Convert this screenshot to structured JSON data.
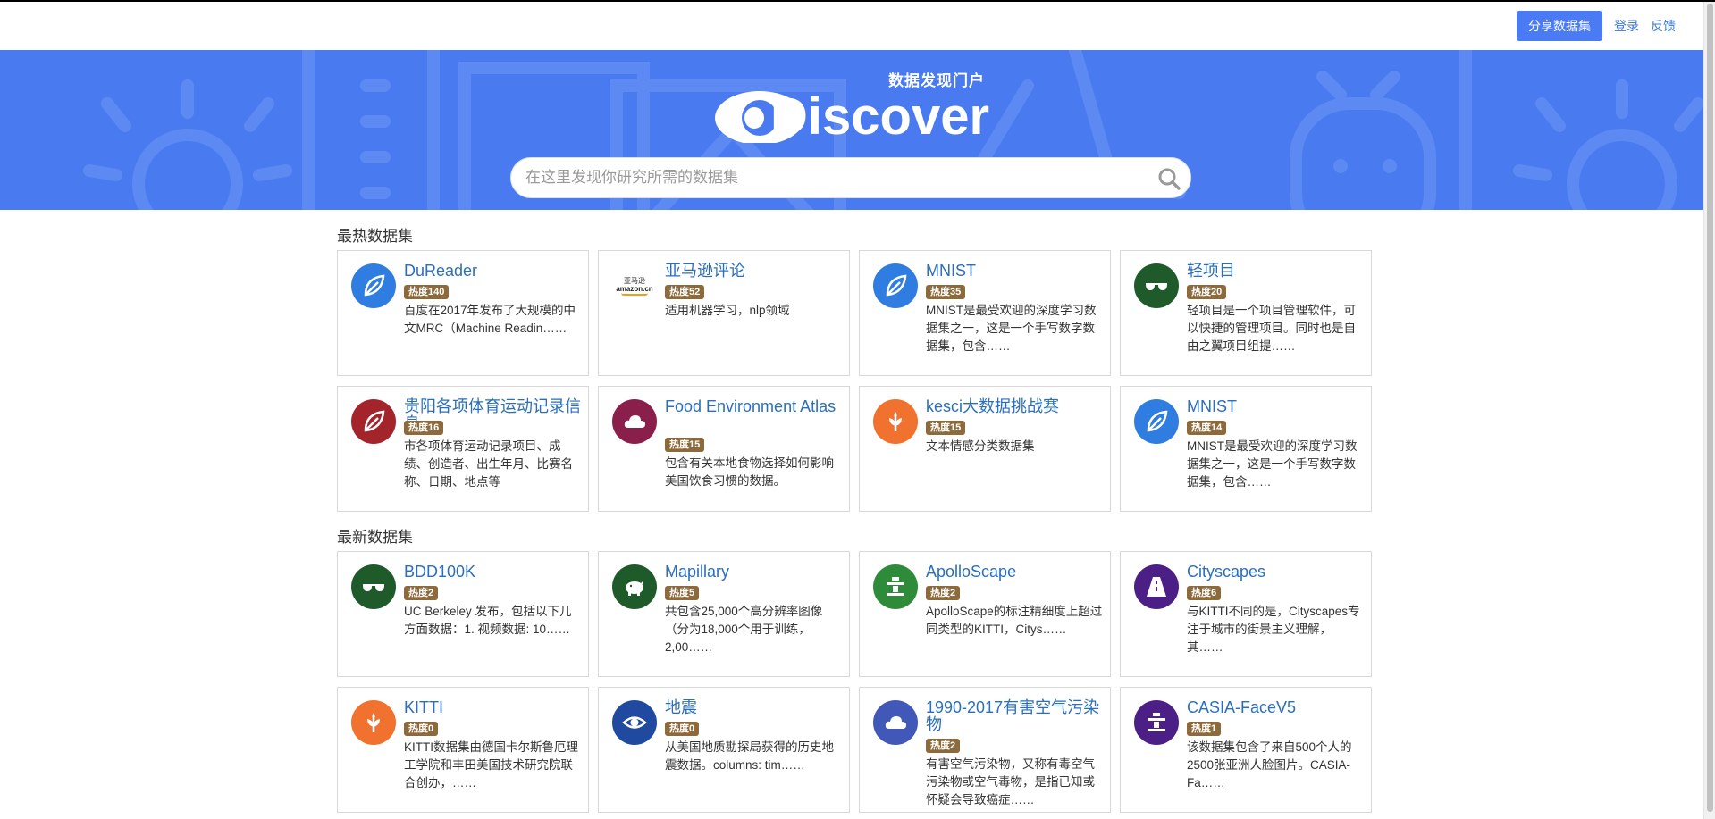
{
  "nav": {
    "share_label": "分享数据集",
    "login_label": "登录",
    "feedback_label": "反馈"
  },
  "hero": {
    "subtitle": "数据发现门户",
    "logo_text": "Discover",
    "search_placeholder": "在这里发现你研究所需的数据集"
  },
  "hot": {
    "title": "最热数据集",
    "cards": [
      {
        "title": "DuReader",
        "badge": "热度140",
        "desc": "百度在2017年发布了大规模的中文MRC（Machine Readin……",
        "icon": "leaf-icon",
        "color": "#2f7de1"
      },
      {
        "title": "亚马逊评论",
        "badge": "热度52",
        "desc": "适用机器学习，nlp领域",
        "icon": "amazon-logo",
        "logo_text": "亚马逊",
        "logo_sub": "amazon.cn"
      },
      {
        "title": "MNIST",
        "badge": "热度35",
        "desc": "MNIST是最受欢迎的深度学习数据集之一，这是一个手写数字数据集，包含……",
        "icon": "leaf-icon",
        "color": "#2f7de1"
      },
      {
        "title": "轻项目",
        "badge": "热度20",
        "desc": "轻项目是一个项目管理软件，可以快捷的管理项目。同时也是自由之翼项目组提……",
        "icon": "glasses-icon",
        "color": "#1f5a2a"
      },
      {
        "title": "贵阳各项体育运动记录信息",
        "badge": "热度16",
        "desc": "市各项体育运动记录项目、成绩、创造者、出生年月、比赛名称、日期、地点等",
        "icon": "leaf-icon",
        "color": "#a4242c"
      },
      {
        "title": "Food Environment Atlas",
        "badge": "热度15",
        "desc": "包含有关本地食物选择如何影响美国饮食习惯的数据。",
        "icon": "cloud-icon",
        "color": "#8a1f4c"
      },
      {
        "title": "kesci大数据挑战赛",
        "badge": "热度15",
        "desc": "文本情感分类数据集",
        "icon": "sprout-icon",
        "color": "#f0722e"
      },
      {
        "title": "MNIST",
        "badge": "热度14",
        "desc": "MNIST是最受欢迎的深度学习数据集之一，这是一个手写数字数据集，包含……",
        "icon": "leaf-icon",
        "color": "#2f7de1"
      }
    ]
  },
  "latest": {
    "title": "最新数据集",
    "cards": [
      {
        "title": "BDD100K",
        "badge": "热度2",
        "desc": "UC Berkeley 发布，包括以下几方面数据：1. 视频数据: 10……",
        "icon": "glasses-icon",
        "color": "#1f5a2a"
      },
      {
        "title": "Mapillary",
        "badge": "热度5",
        "desc": "共包含25,000个高分辨率图像（分为18,000个用于训练，2,00……",
        "icon": "piggy-bank-icon",
        "color": "#1f5a2a"
      },
      {
        "title": "ApolloScape",
        "badge": "热度2",
        "desc": "ApolloScape的标注精细度上超过同类型的KITTI，Citys……",
        "icon": "monument-icon",
        "color": "#2e8b3a"
      },
      {
        "title": "Cityscapes",
        "badge": "热度6",
        "desc": "与KITTI不同的是，Cityscapes专注于城市的街景主义理解，其……",
        "icon": "road-icon",
        "color": "#4b1f86"
      },
      {
        "title": "KITTI",
        "badge": "热度0",
        "desc": "KITTI数据集由德国卡尔斯鲁厄理工学院和丰田美国技术研究院联合创办，……",
        "icon": "sprout-icon",
        "color": "#f0722e"
      },
      {
        "title": "地震",
        "badge": "热度0",
        "desc": "从美国地质勘探局获得的历史地震数据。columns: tim……",
        "icon": "eye-icon",
        "color": "#1f4aa0"
      },
      {
        "title": "1990-2017有害空气污染物",
        "badge": "热度2",
        "desc": "有害空气污染物，又称有毒空气污染物或空气毒物，是指已知或怀疑会导致癌症……",
        "icon": "cloud-icon",
        "color": "#4158b8"
      },
      {
        "title": "CASIA-FaceV5",
        "badge": "热度1",
        "desc": "该数据集包含了来自500个人的2500张亚洲人脸图片。CASIA-Fa……",
        "icon": "monument-icon",
        "color": "#4b1f86"
      }
    ]
  }
}
